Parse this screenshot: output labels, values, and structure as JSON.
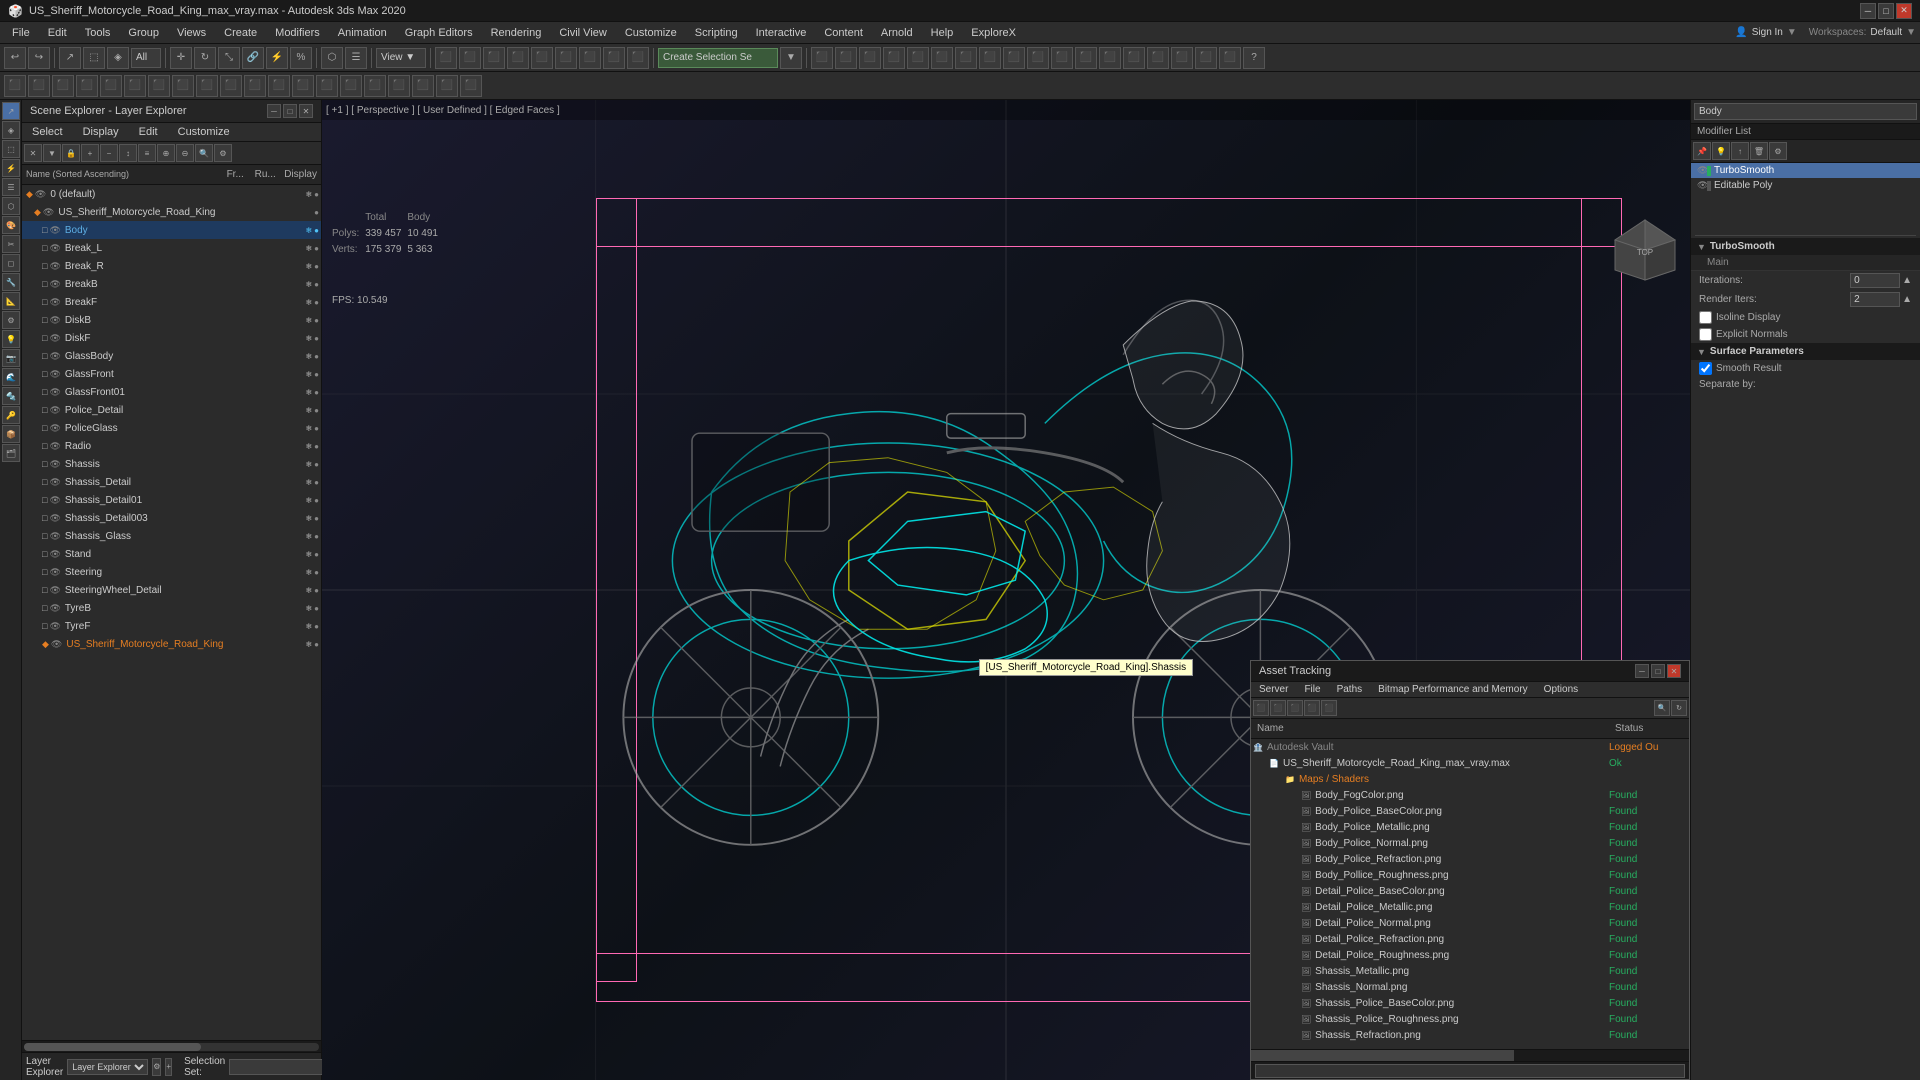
{
  "titleBar": {
    "title": "US_Sheriff_Motorcycle_Road_King_max_vray.max - Autodesk 3ds Max 2020",
    "minBtn": "─",
    "maxBtn": "□",
    "closeBtn": "✕"
  },
  "menuBar": {
    "items": [
      "File",
      "Edit",
      "Tools",
      "Group",
      "Views",
      "Create",
      "Modifiers",
      "Animation",
      "Graph Editors",
      "Rendering",
      "Civil View",
      "Customize",
      "Scripting",
      "Interactive",
      "Content",
      "Arnold",
      "Help",
      "ExploreX"
    ]
  },
  "toolbar": {
    "viewLabel": "View",
    "createSelectionLabel": "Create Selection Se",
    "percentLabel": "All"
  },
  "viewport": {
    "header": "[ +1 ] [ Perspective ] [ User Defined ] [ Edged Faces ]",
    "stats": {
      "totalLabel": "Total",
      "bodyLabel": "Body",
      "polysLabel": "Polys:",
      "polysTotal": "339 457",
      "polysBody": "10 491",
      "vertsLabel": "Verts:",
      "vertsTotal": "175 379",
      "vertsBody": "5 363"
    },
    "fps": {
      "label": "FPS:",
      "value": "10.549"
    },
    "tooltip": "[US_Sheriff_Motorcycle_Road_King].Shassis"
  },
  "sceneExplorer": {
    "title": "Scene Explorer - Layer Explorer",
    "menuItems": [
      "Select",
      "Display",
      "Edit",
      "Customize"
    ],
    "columns": {
      "name": "Name (Sorted Ascending)",
      "fr": "Fr...",
      "ru": "Ru...",
      "display": "Display"
    },
    "rows": [
      {
        "indent": 0,
        "icon": "◆",
        "name": "0 (default)",
        "type": "layer",
        "hasEye": true,
        "hasDot": true,
        "dotColor": "#888",
        "hasSnow": false
      },
      {
        "indent": 1,
        "icon": "◆",
        "name": "US_Sheriff_Motorcycle_Road_King",
        "type": "group",
        "hasEye": true,
        "hasDot": true,
        "dotColor": "#888",
        "hasSnow": false
      },
      {
        "indent": 2,
        "icon": "□",
        "name": "Body",
        "type": "mesh",
        "hasEye": true,
        "hasDot": false,
        "hasSnow": true,
        "selected": true
      },
      {
        "indent": 2,
        "icon": "□",
        "name": "Break_L",
        "type": "mesh",
        "hasEye": true,
        "hasDot": false,
        "hasSnow": true
      },
      {
        "indent": 2,
        "icon": "□",
        "name": "Break_R",
        "type": "mesh",
        "hasEye": true,
        "hasDot": false,
        "hasSnow": true
      },
      {
        "indent": 2,
        "icon": "□",
        "name": "BreakB",
        "type": "mesh",
        "hasEye": true,
        "hasDot": false,
        "hasSnow": true
      },
      {
        "indent": 2,
        "icon": "□",
        "name": "BreakF",
        "type": "mesh",
        "hasEye": true,
        "hasDot": false,
        "hasSnow": true
      },
      {
        "indent": 2,
        "icon": "□",
        "name": "DiskB",
        "type": "mesh",
        "hasEye": true,
        "hasDot": false,
        "hasSnow": true
      },
      {
        "indent": 2,
        "icon": "□",
        "name": "DiskF",
        "type": "mesh",
        "hasEye": true,
        "hasDot": false,
        "hasSnow": true
      },
      {
        "indent": 2,
        "icon": "□",
        "name": "GlassBody",
        "type": "mesh",
        "hasEye": true,
        "hasDot": false,
        "hasSnow": true
      },
      {
        "indent": 2,
        "icon": "□",
        "name": "GlassFront",
        "type": "mesh",
        "hasEye": true,
        "hasDot": false,
        "hasSnow": true
      },
      {
        "indent": 2,
        "icon": "□",
        "name": "GlassFront01",
        "type": "mesh",
        "hasEye": true,
        "hasDot": false,
        "hasSnow": true
      },
      {
        "indent": 2,
        "icon": "□",
        "name": "Police_Detail",
        "type": "mesh",
        "hasEye": true,
        "hasDot": false,
        "hasSnow": true
      },
      {
        "indent": 2,
        "icon": "□",
        "name": "PoliceGlass",
        "type": "mesh",
        "hasEye": true,
        "hasDot": false,
        "hasSnow": true
      },
      {
        "indent": 2,
        "icon": "□",
        "name": "Radio",
        "type": "mesh",
        "hasEye": true,
        "hasDot": false,
        "hasSnow": true
      },
      {
        "indent": 2,
        "icon": "□",
        "name": "Shassis",
        "type": "mesh",
        "hasEye": true,
        "hasDot": false,
        "hasSnow": true
      },
      {
        "indent": 2,
        "icon": "□",
        "name": "Shassis_Detail",
        "type": "mesh",
        "hasEye": true,
        "hasDot": false,
        "hasSnow": true
      },
      {
        "indent": 2,
        "icon": "□",
        "name": "Shassis_Detail01",
        "type": "mesh",
        "hasEye": true,
        "hasDot": false,
        "hasSnow": true
      },
      {
        "indent": 2,
        "icon": "□",
        "name": "Shassis_Detail003",
        "type": "mesh",
        "hasEye": true,
        "hasDot": false,
        "hasSnow": true
      },
      {
        "indent": 2,
        "icon": "□",
        "name": "Shassis_Glass",
        "type": "mesh",
        "hasEye": true,
        "hasDot": false,
        "hasSnow": true
      },
      {
        "indent": 2,
        "icon": "□",
        "name": "Stand",
        "type": "mesh",
        "hasEye": true,
        "hasDot": false,
        "hasSnow": true
      },
      {
        "indent": 2,
        "icon": "□",
        "name": "Steering",
        "type": "mesh",
        "hasEye": true,
        "hasDot": false,
        "hasSnow": true
      },
      {
        "indent": 2,
        "icon": "□",
        "name": "SteeringWheel_Detail",
        "type": "mesh",
        "hasEye": true,
        "hasDot": false,
        "hasSnow": true
      },
      {
        "indent": 2,
        "icon": "□",
        "name": "TyreB",
        "type": "mesh",
        "hasEye": true,
        "hasDot": false,
        "hasSnow": true
      },
      {
        "indent": 2,
        "icon": "□",
        "name": "TyreF",
        "type": "mesh",
        "hasEye": true,
        "hasDot": false,
        "hasSnow": true
      },
      {
        "indent": 2,
        "icon": "◆",
        "name": "US_Sheriff_Motorcycle_Road_King",
        "type": "group2",
        "hasEye": true,
        "hasDot": false,
        "hasSnow": true
      }
    ],
    "bottomLabel": "Layer Explorer",
    "selectionSet": "Selection Set:"
  },
  "rightPanel": {
    "searchPlaceholder": "Body",
    "modifierListLabel": "Modifier List",
    "modifiers": [
      {
        "name": "TurboSmooth",
        "selected": true
      },
      {
        "name": "Editable Poly",
        "selected": false
      }
    ],
    "turboSmooth": {
      "sectionLabel": "TurboSmooth",
      "mainLabel": "Main",
      "iterationsLabel": "Iterations:",
      "iterationsValue": "0",
      "renderItersLabel": "Render Iters:",
      "renderItersValue": "2",
      "isoLineDisplay": "Isoline Display",
      "explicitNormals": "Explicit Normals",
      "surfaceParams": "Surface Parameters",
      "smoothResult": "Smooth Result",
      "separateBy": "Separate by:"
    }
  },
  "assetTracking": {
    "title": "Asset Tracking",
    "menuItems": [
      "Server",
      "File",
      "Paths",
      "Bitmap Performance and Memory",
      "Options"
    ],
    "columns": {
      "name": "Name",
      "status": "Status"
    },
    "rows": [
      {
        "indent": 0,
        "type": "vault",
        "icon": "🏦",
        "name": "Autodesk Vault",
        "status": "Logged Ou",
        "statusClass": "logged"
      },
      {
        "indent": 1,
        "type": "file",
        "icon": "📄",
        "name": "US_Sheriff_Motorcycle_Road_King_max_vray.max",
        "status": "Ok",
        "statusClass": ""
      },
      {
        "indent": 2,
        "type": "folder",
        "icon": "📁",
        "name": "Maps / Shaders",
        "status": "",
        "statusClass": ""
      },
      {
        "indent": 3,
        "type": "map",
        "icon": "🖼",
        "name": "Body_FogColor.png",
        "status": "Found",
        "statusClass": ""
      },
      {
        "indent": 3,
        "type": "map",
        "icon": "🖼",
        "name": "Body_Police_BaseColor.png",
        "status": "Found",
        "statusClass": ""
      },
      {
        "indent": 3,
        "type": "map",
        "icon": "🖼",
        "name": "Body_Police_Metallic.png",
        "status": "Found",
        "statusClass": ""
      },
      {
        "indent": 3,
        "type": "map",
        "icon": "🖼",
        "name": "Body_Police_Normal.png",
        "status": "Found",
        "statusClass": ""
      },
      {
        "indent": 3,
        "type": "map",
        "icon": "🖼",
        "name": "Body_Police_Refraction.png",
        "status": "Found",
        "statusClass": ""
      },
      {
        "indent": 3,
        "type": "map",
        "icon": "🖼",
        "name": "Body_Pollice_Roughness.png",
        "status": "Found",
        "statusClass": ""
      },
      {
        "indent": 3,
        "type": "map",
        "icon": "🖼",
        "name": "Detail_Police_BaseColor.png",
        "status": "Found",
        "statusClass": ""
      },
      {
        "indent": 3,
        "type": "map",
        "icon": "🖼",
        "name": "Detail_Police_Metallic.png",
        "status": "Found",
        "statusClass": ""
      },
      {
        "indent": 3,
        "type": "map",
        "icon": "🖼",
        "name": "Detail_Police_Normal.png",
        "status": "Found",
        "statusClass": ""
      },
      {
        "indent": 3,
        "type": "map",
        "icon": "🖼",
        "name": "Detail_Police_Refraction.png",
        "status": "Found",
        "statusClass": ""
      },
      {
        "indent": 3,
        "type": "map",
        "icon": "🖼",
        "name": "Detail_Police_Roughness.png",
        "status": "Found",
        "statusClass": ""
      },
      {
        "indent": 3,
        "type": "map",
        "icon": "🖼",
        "name": "Shassis_Metallic.png",
        "status": "Found",
        "statusClass": ""
      },
      {
        "indent": 3,
        "type": "map",
        "icon": "🖼",
        "name": "Shassis_Normal.png",
        "status": "Found",
        "statusClass": ""
      },
      {
        "indent": 3,
        "type": "map",
        "icon": "🖼",
        "name": "Shassis_Police_BaseColor.png",
        "status": "Found",
        "statusClass": ""
      },
      {
        "indent": 3,
        "type": "map",
        "icon": "🖼",
        "name": "Shassis_Police_Roughness.png",
        "status": "Found",
        "statusClass": ""
      },
      {
        "indent": 3,
        "type": "map",
        "icon": "🖼",
        "name": "Shassis_Refraction.png",
        "status": "Found",
        "statusClass": ""
      }
    ]
  }
}
